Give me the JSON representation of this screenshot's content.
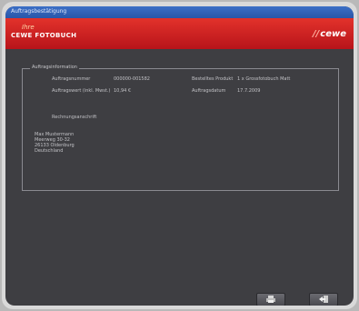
{
  "window": {
    "title": "Auftragsbestätigung"
  },
  "brand": {
    "left_script": "Ihre",
    "left_main": "CEWE FOTOBUCH",
    "right": "cewe"
  },
  "group": {
    "title": "Auftragsinformation",
    "order_number_label": "Auftragsnummer",
    "order_number_value": "000000-001582",
    "order_value_label": "Auftragswert (inkl. Mwst.)",
    "order_value_value": "10,94 €",
    "ordered_product_label": "Bestelltes Produkt",
    "ordered_product_value": "1 x Grossfotobuch Matt",
    "order_date_label": "Auftragsdatum",
    "order_date_value": "17.7.2009",
    "billing_label": "Rechnungsanschrift",
    "address": [
      "Max Mustermann",
      "Meerweg 30-32",
      "26133 Oldenburg",
      "Deutschland"
    ]
  },
  "buttons": {
    "print_icon": "printer-icon",
    "exit_icon": "exit-icon"
  }
}
